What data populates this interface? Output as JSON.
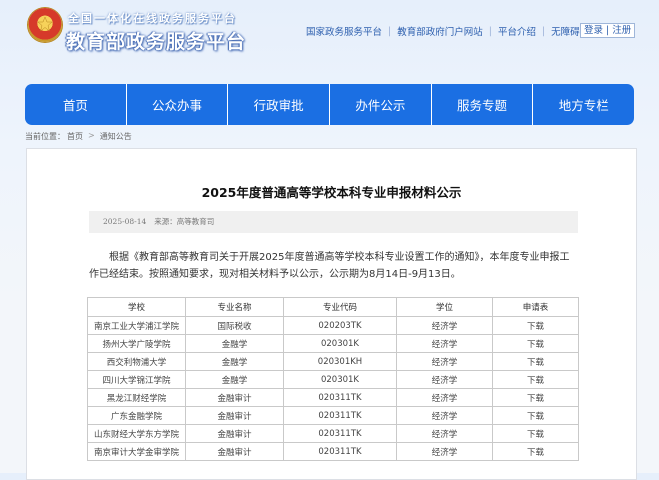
{
  "header": {
    "slogan": "全国一体化在线政务服务平台",
    "title": "教育部政务服务平台",
    "links": [
      "国家政务服务平台",
      "教育部政府门户网站",
      "平台介绍",
      "无障碍浏览"
    ],
    "login": "登录 | 注册"
  },
  "nav": [
    "首页",
    "公众办事",
    "行政审批",
    "办件公示",
    "服务专题",
    "地方专栏"
  ],
  "breadcrumb": {
    "label": "当前位置：",
    "items": [
      "首页",
      "通知公告"
    ]
  },
  "article": {
    "title": "2025年度普通高等学校本科专业申报材料公示",
    "date": "2025-08-14",
    "source": "来源：高等教育司",
    "paragraph": "根据《教育部高等教育司关于开展2025年度普通高等学校本科专业设置工作的通知》，本年度专业申报工作已经结束。按照通知要求，现对相关材料予以公示，公示期为8月14日-9月13日。"
  },
  "table": {
    "headers": [
      "学校",
      "专业名称",
      "专业代码",
      "学位",
      "申请表"
    ],
    "rows": [
      [
        "南京工业大学浦江学院",
        "国际税收",
        "020203TK",
        "经济学",
        "下载"
      ],
      [
        "扬州大学广陵学院",
        "金融学",
        "020301K",
        "经济学",
        "下载"
      ],
      [
        "西交利物浦大学",
        "金融学",
        "020301KH",
        "经济学",
        "下载"
      ],
      [
        "四川大学锦江学院",
        "金融学",
        "020301K",
        "经济学",
        "下载"
      ],
      [
        "黑龙江财经学院",
        "金融审计",
        "020311TK",
        "经济学",
        "下载"
      ],
      [
        "广东金融学院",
        "金融审计",
        "020311TK",
        "经济学",
        "下载"
      ],
      [
        "山东财经大学东方学院",
        "金融审计",
        "020311TK",
        "经济学",
        "下载"
      ],
      [
        "南京审计大学金审学院",
        "金融审计",
        "020311TK",
        "经济学",
        "下载"
      ]
    ]
  },
  "colors": {
    "nav_blue": "#1b6fe3",
    "link_blue": "#2d5fae"
  }
}
